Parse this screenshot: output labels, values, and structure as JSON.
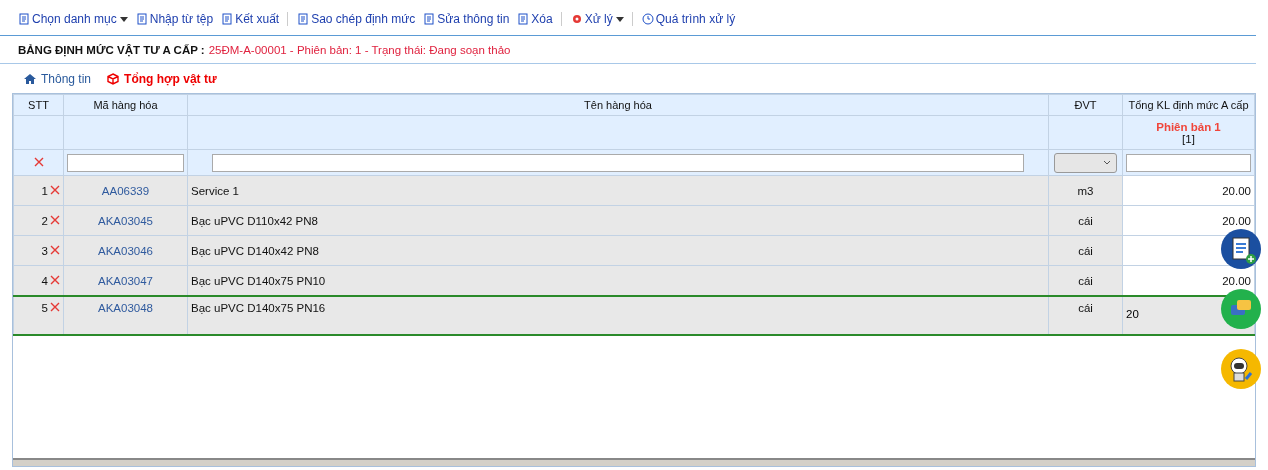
{
  "toolbar": [
    {
      "label": "Chọn danh mục",
      "dropdown": true,
      "separator_before": false
    },
    {
      "label": "Nhập từ tệp",
      "dropdown": false,
      "separator_before": false
    },
    {
      "label": "Kết xuất",
      "dropdown": false,
      "separator_before": false
    },
    {
      "label": "Sao chép định mức",
      "dropdown": false,
      "separator_before": true
    },
    {
      "label": "Sửa thông tin",
      "dropdown": false,
      "separator_before": false
    },
    {
      "label": "Xóa",
      "dropdown": false,
      "separator_before": false
    },
    {
      "label": "Xử lý",
      "dropdown": true,
      "separator_before": true
    },
    {
      "label": "Quá trình xử lý",
      "dropdown": false,
      "separator_before": true
    }
  ],
  "heading": {
    "label": "BẢNG ĐỊNH MỨC VẬT TƯ A CẤP :",
    "detail": "25ĐM-A-00001 - Phiên bản: 1 - Trạng thái: Đang soạn thảo"
  },
  "tabs": [
    {
      "label": "Thông tin",
      "selected": false
    },
    {
      "label": "Tổng hợp vật tư",
      "selected": true
    }
  ],
  "table": {
    "columns": [
      "STT",
      "Mã hàng hóa",
      "Tên hàng hóa",
      "ĐVT",
      "Tổng KL định mức A cấp"
    ],
    "version": {
      "label": "Phiên bản 1",
      "index": "[1]"
    },
    "rows": [
      {
        "stt": "1",
        "code": "AA06339",
        "name": "Service 1",
        "unit": "m3",
        "total": "20.00",
        "editing": false
      },
      {
        "stt": "2",
        "code": "AKA03045",
        "name": "Bạc uPVC D110x42 PN8",
        "unit": "cái",
        "total": "20.00",
        "editing": false
      },
      {
        "stt": "3",
        "code": "AKA03046",
        "name": "Bạc uPVC D140x42 PN8",
        "unit": "cái",
        "editing": false
      },
      {
        "stt": "4",
        "code": "AKA03047",
        "name": "Bạc uPVC D140x75 PN10",
        "unit": "cái",
        "total": "20.00",
        "editing": false
      },
      {
        "stt": "5",
        "code": "AKA03048",
        "name": "Bạc uPVC D140x75 PN16",
        "unit": "cái",
        "total": "20",
        "editing": true
      }
    ]
  }
}
